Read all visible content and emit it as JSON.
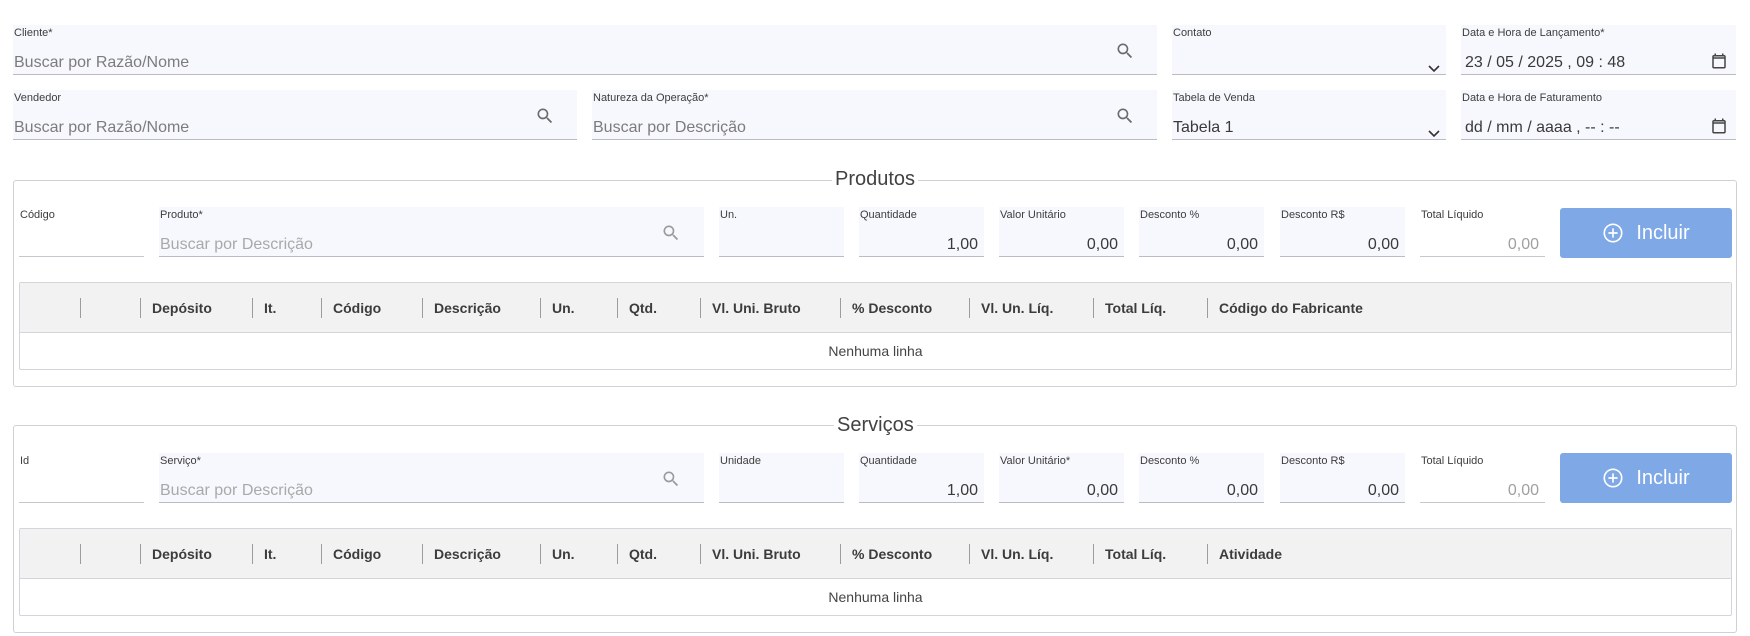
{
  "header": {
    "cliente": {
      "label": "Cliente*",
      "placeholder": "Buscar por Razão/Nome"
    },
    "contato": {
      "label": "Contato",
      "value": ""
    },
    "lancamento": {
      "label": "Data e Hora de Lançamento*",
      "value": "23 / 05 / 2025 ,  09 : 48"
    },
    "vendedor": {
      "label": "Vendedor",
      "placeholder": "Buscar por Razão/Nome"
    },
    "natureza": {
      "label": "Natureza da Operação*",
      "placeholder": "Buscar por Descrição"
    },
    "tabela": {
      "label": "Tabela de Venda",
      "value": "Tabela 1"
    },
    "faturamento": {
      "label": "Data e Hora de Faturamento",
      "value": "dd / mm / aaaa ,  -- : --"
    }
  },
  "produtos": {
    "title": "Produtos",
    "codigo_label": "Código",
    "item_label": "Produto*",
    "item_placeholder": "Buscar por Descrição",
    "un_label": "Un.",
    "quantidade_label": "Quantidade",
    "quantidade_value": "1,00",
    "valor_label": "Valor Unitário",
    "valor_value": "0,00",
    "desc_pct_label": "Desconto %",
    "desc_pct_value": "0,00",
    "desc_rs_label": "Desconto R$",
    "desc_rs_value": "0,00",
    "total_label": "Total Líquido",
    "total_value": "0,00",
    "button_label": "Incluir",
    "columns": [
      "Depósito",
      "It.",
      "Código",
      "Descrição",
      "Un.",
      "Qtd.",
      "Vl. Uni. Bruto",
      "% Desconto",
      "Vl. Un. Líq.",
      "Total Líq.",
      "Código do Fabricante"
    ],
    "empty_text": "Nenhuma linha"
  },
  "servicos": {
    "title": "Serviços",
    "codigo_label": "Id",
    "item_label": "Serviço*",
    "item_placeholder": "Buscar por Descrição",
    "un_label": "Unidade",
    "quantidade_label": "Quantidade",
    "quantidade_value": "1,00",
    "valor_label": "Valor Unitário*",
    "valor_value": "0,00",
    "desc_pct_label": "Desconto %",
    "desc_pct_value": "0,00",
    "desc_rs_label": "Desconto R$",
    "desc_rs_value": "0,00",
    "total_label": "Total Líquido",
    "total_value": "0,00",
    "button_label": "Incluir",
    "columns": [
      "Depósito",
      "It.",
      "Código",
      "Descrição",
      "Un.",
      "Qtd.",
      "Vl. Uni. Bruto",
      "% Desconto",
      "Vl. Un. Líq.",
      "Total Líq.",
      "Atividade"
    ],
    "empty_text": "Nenhuma linha"
  },
  "colors": {
    "accent_button": "#7ea8e6",
    "field_bg": "#f7f8fd",
    "grid_header": "#f2f2f2"
  },
  "icons": {
    "search": "search-icon",
    "add": "add-circle-icon",
    "calendar": "calendar-icon",
    "dropdown": "chevron-down-icon"
  }
}
